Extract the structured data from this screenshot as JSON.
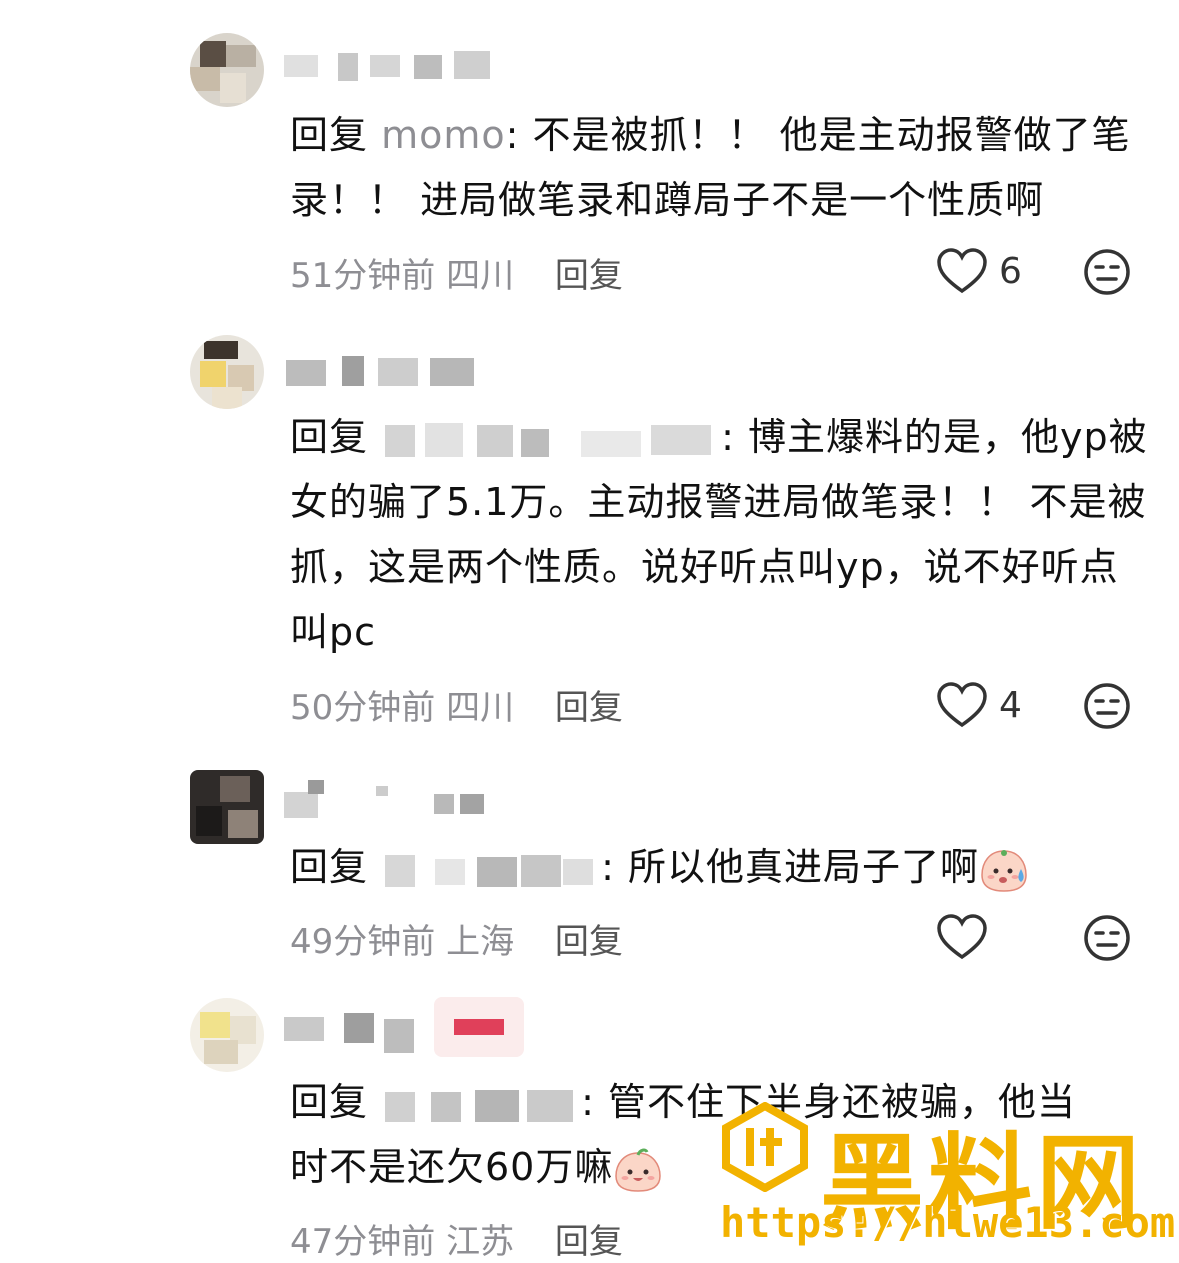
{
  "comments": [
    {
      "reply_prefix": "回复",
      "reply_target": "momo",
      "text": ": 不是被抓！！ 他是主动报警做了笔录！！ 进局做笔录和蹲局子不是一个性质啊",
      "time": "51分钟前",
      "location": "四川",
      "reply_label": "回复",
      "likes": "6"
    },
    {
      "reply_prefix": "回复",
      "text": ": 博主爆料的是，他yp被女的骗了5.1万。主动报警进局做笔录！！ 不是被抓，这是两个性质。说好听点叫yp，说不好听点叫pc",
      "time": "50分钟前",
      "location": "四川",
      "reply_label": "回复",
      "likes": "4"
    },
    {
      "reply_prefix": "回复",
      "text": ": 所以他真进局子了啊",
      "time": "49分钟前",
      "location": "上海",
      "reply_label": "回复",
      "likes": ""
    },
    {
      "reply_prefix": "回复",
      "text_line1": ": 管不住下半身还被骗，他当",
      "text_line2": "时不是还欠60万嘛",
      "time": "47分钟前",
      "location": "江苏",
      "reply_label": "回复"
    }
  ],
  "icons": [
    "heart-outline-icon",
    "unhappy-face-icon",
    "sweat-face-emoji",
    "smile-face-emoji"
  ],
  "watermark": {
    "title": "黑料网",
    "url": "https://hlwe13.com",
    "color": "#f2b200"
  }
}
